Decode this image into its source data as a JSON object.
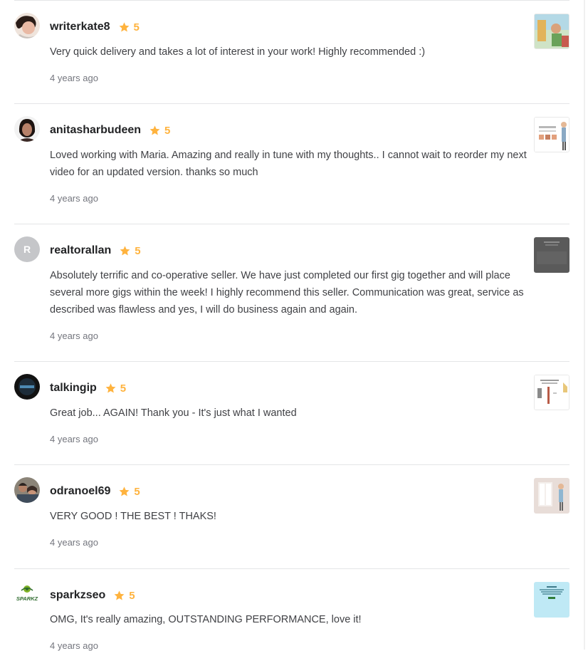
{
  "reviews": [
    {
      "username": "writerkate8",
      "rating": "5",
      "text": "Very quick delivery and takes a lot of interest in your work! Highly recommended :)",
      "time": "4 years ago",
      "avatar_icon": "user-photo"
    },
    {
      "username": "anitasharbudeen",
      "rating": "5",
      "text": "Loved working with Maria. Amazing and really in tune with my thoughts.. I cannot wait to reorder my next video for an updated version. thanks so much",
      "time": "4 years ago",
      "avatar_icon": "user-photo"
    },
    {
      "username": "realtorallan",
      "rating": "5",
      "avatar_letter": "R",
      "text": "Absolutely terrific and co-operative seller. We have just completed our first gig together and will place several more gigs within the week! I highly recommend this seller. Communication was great, service as described was flawless and yes, I will do business again and again.",
      "time": "4 years ago"
    },
    {
      "username": "talkingip",
      "rating": "5",
      "text": "Great job... AGAIN! Thank you - It's just what I wanted",
      "time": "4 years ago",
      "avatar_icon": "user-logo"
    },
    {
      "username": "odranoel69",
      "rating": "5",
      "text": "VERY GOOD ! THE BEST ! THAKS!",
      "time": "4 years ago",
      "avatar_icon": "user-photo"
    },
    {
      "username": "sparkzseo",
      "rating": "5",
      "avatar_logo_text": "SPARKZ",
      "text": "OMG, It's really amazing, OUTSTANDING PERFORMANCE, love it!",
      "time": "4 years ago"
    }
  ],
  "colors": {
    "star": "#ffb33e",
    "username": "#222325",
    "text": "#404145",
    "muted": "#74767e",
    "divider": "#e4e5e7"
  }
}
